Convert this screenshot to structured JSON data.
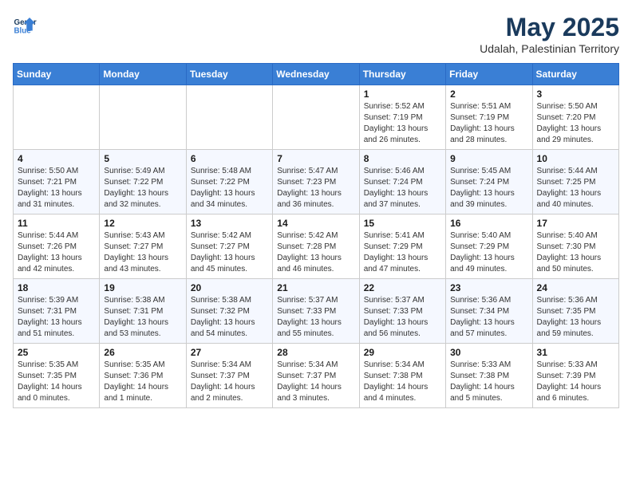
{
  "logo": {
    "line1": "General",
    "line2": "Blue"
  },
  "title": "May 2025",
  "subtitle": "Udalah, Palestinian Territory",
  "weekdays": [
    "Sunday",
    "Monday",
    "Tuesday",
    "Wednesday",
    "Thursday",
    "Friday",
    "Saturday"
  ],
  "weeks": [
    [
      {
        "day": "",
        "info": ""
      },
      {
        "day": "",
        "info": ""
      },
      {
        "day": "",
        "info": ""
      },
      {
        "day": "",
        "info": ""
      },
      {
        "day": "1",
        "info": "Sunrise: 5:52 AM\nSunset: 7:19 PM\nDaylight: 13 hours\nand 26 minutes."
      },
      {
        "day": "2",
        "info": "Sunrise: 5:51 AM\nSunset: 7:19 PM\nDaylight: 13 hours\nand 28 minutes."
      },
      {
        "day": "3",
        "info": "Sunrise: 5:50 AM\nSunset: 7:20 PM\nDaylight: 13 hours\nand 29 minutes."
      }
    ],
    [
      {
        "day": "4",
        "info": "Sunrise: 5:50 AM\nSunset: 7:21 PM\nDaylight: 13 hours\nand 31 minutes."
      },
      {
        "day": "5",
        "info": "Sunrise: 5:49 AM\nSunset: 7:22 PM\nDaylight: 13 hours\nand 32 minutes."
      },
      {
        "day": "6",
        "info": "Sunrise: 5:48 AM\nSunset: 7:22 PM\nDaylight: 13 hours\nand 34 minutes."
      },
      {
        "day": "7",
        "info": "Sunrise: 5:47 AM\nSunset: 7:23 PM\nDaylight: 13 hours\nand 36 minutes."
      },
      {
        "day": "8",
        "info": "Sunrise: 5:46 AM\nSunset: 7:24 PM\nDaylight: 13 hours\nand 37 minutes."
      },
      {
        "day": "9",
        "info": "Sunrise: 5:45 AM\nSunset: 7:24 PM\nDaylight: 13 hours\nand 39 minutes."
      },
      {
        "day": "10",
        "info": "Sunrise: 5:44 AM\nSunset: 7:25 PM\nDaylight: 13 hours\nand 40 minutes."
      }
    ],
    [
      {
        "day": "11",
        "info": "Sunrise: 5:44 AM\nSunset: 7:26 PM\nDaylight: 13 hours\nand 42 minutes."
      },
      {
        "day": "12",
        "info": "Sunrise: 5:43 AM\nSunset: 7:27 PM\nDaylight: 13 hours\nand 43 minutes."
      },
      {
        "day": "13",
        "info": "Sunrise: 5:42 AM\nSunset: 7:27 PM\nDaylight: 13 hours\nand 45 minutes."
      },
      {
        "day": "14",
        "info": "Sunrise: 5:42 AM\nSunset: 7:28 PM\nDaylight: 13 hours\nand 46 minutes."
      },
      {
        "day": "15",
        "info": "Sunrise: 5:41 AM\nSunset: 7:29 PM\nDaylight: 13 hours\nand 47 minutes."
      },
      {
        "day": "16",
        "info": "Sunrise: 5:40 AM\nSunset: 7:29 PM\nDaylight: 13 hours\nand 49 minutes."
      },
      {
        "day": "17",
        "info": "Sunrise: 5:40 AM\nSunset: 7:30 PM\nDaylight: 13 hours\nand 50 minutes."
      }
    ],
    [
      {
        "day": "18",
        "info": "Sunrise: 5:39 AM\nSunset: 7:31 PM\nDaylight: 13 hours\nand 51 minutes."
      },
      {
        "day": "19",
        "info": "Sunrise: 5:38 AM\nSunset: 7:31 PM\nDaylight: 13 hours\nand 53 minutes."
      },
      {
        "day": "20",
        "info": "Sunrise: 5:38 AM\nSunset: 7:32 PM\nDaylight: 13 hours\nand 54 minutes."
      },
      {
        "day": "21",
        "info": "Sunrise: 5:37 AM\nSunset: 7:33 PM\nDaylight: 13 hours\nand 55 minutes."
      },
      {
        "day": "22",
        "info": "Sunrise: 5:37 AM\nSunset: 7:33 PM\nDaylight: 13 hours\nand 56 minutes."
      },
      {
        "day": "23",
        "info": "Sunrise: 5:36 AM\nSunset: 7:34 PM\nDaylight: 13 hours\nand 57 minutes."
      },
      {
        "day": "24",
        "info": "Sunrise: 5:36 AM\nSunset: 7:35 PM\nDaylight: 13 hours\nand 59 minutes."
      }
    ],
    [
      {
        "day": "25",
        "info": "Sunrise: 5:35 AM\nSunset: 7:35 PM\nDaylight: 14 hours\nand 0 minutes."
      },
      {
        "day": "26",
        "info": "Sunrise: 5:35 AM\nSunset: 7:36 PM\nDaylight: 14 hours\nand 1 minute."
      },
      {
        "day": "27",
        "info": "Sunrise: 5:34 AM\nSunset: 7:37 PM\nDaylight: 14 hours\nand 2 minutes."
      },
      {
        "day": "28",
        "info": "Sunrise: 5:34 AM\nSunset: 7:37 PM\nDaylight: 14 hours\nand 3 minutes."
      },
      {
        "day": "29",
        "info": "Sunrise: 5:34 AM\nSunset: 7:38 PM\nDaylight: 14 hours\nand 4 minutes."
      },
      {
        "day": "30",
        "info": "Sunrise: 5:33 AM\nSunset: 7:38 PM\nDaylight: 14 hours\nand 5 minutes."
      },
      {
        "day": "31",
        "info": "Sunrise: 5:33 AM\nSunset: 7:39 PM\nDaylight: 14 hours\nand 6 minutes."
      }
    ]
  ]
}
